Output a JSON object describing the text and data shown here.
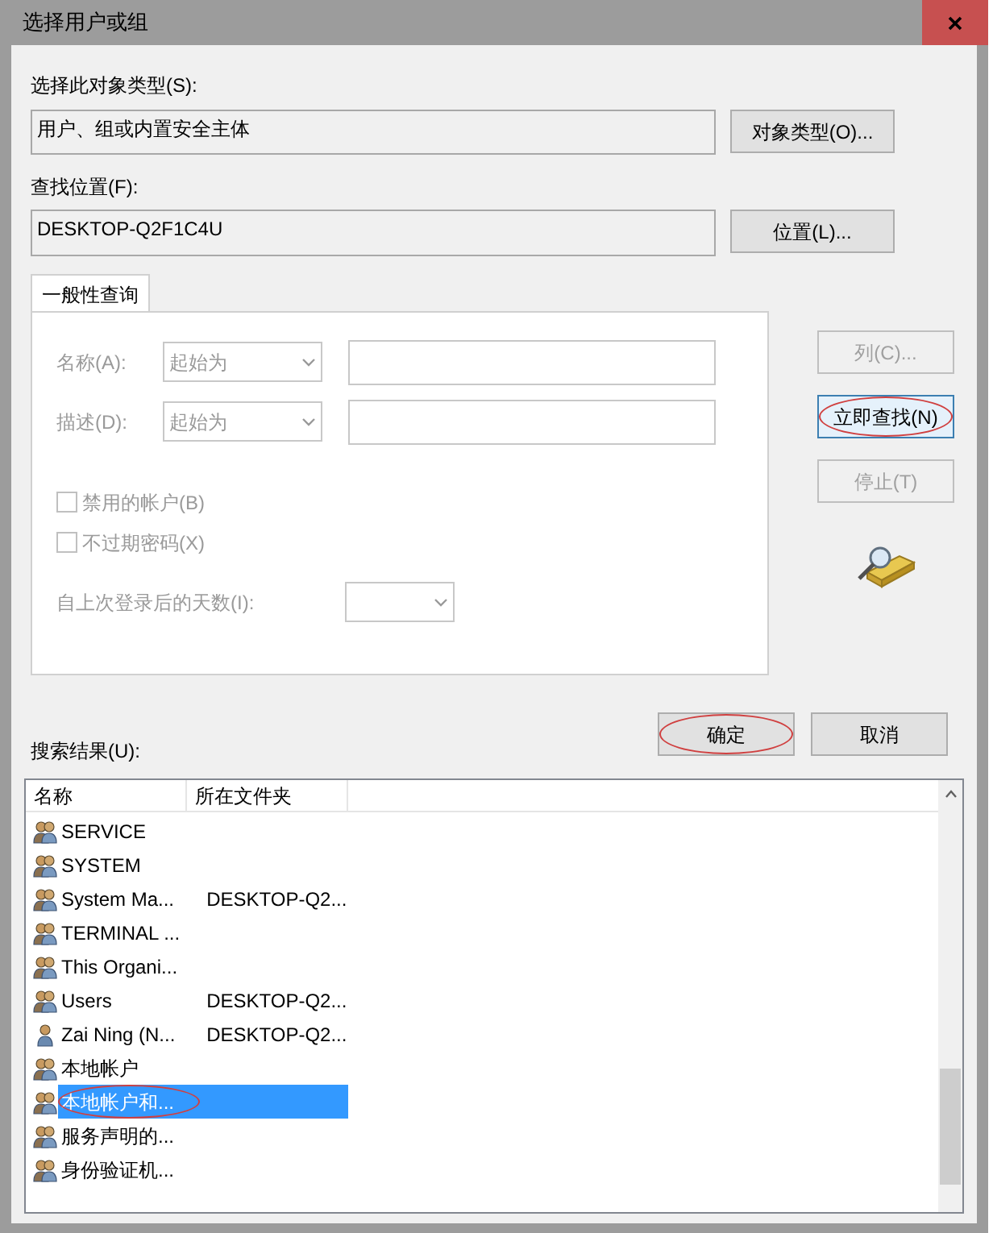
{
  "window": {
    "title": "选择用户或组"
  },
  "object_type": {
    "label": "选择此对象类型(S):",
    "value": "用户、组或内置安全主体",
    "button": "对象类型(O)..."
  },
  "location": {
    "label": "查找位置(F):",
    "value": "DESKTOP-Q2F1C4U",
    "button": "位置(L)..."
  },
  "tabs": [
    {
      "label": "一般性查询",
      "selected": true
    }
  ],
  "query": {
    "disabled": true,
    "fields": [
      {
        "label": "名称(A):",
        "mode": "起始为"
      },
      {
        "label": "描述(D):",
        "mode": "起始为"
      }
    ],
    "checkboxes": [
      {
        "label": "禁用的帐户(B)",
        "checked": false
      },
      {
        "label": "不过期密码(X)",
        "checked": false
      }
    ],
    "days_label": "自上次登录后的天数(I):"
  },
  "side_buttons": [
    {
      "label": "列(C)...",
      "disabled": true,
      "default": false,
      "circled": false
    },
    {
      "label": "立即查找(N)",
      "disabled": false,
      "default": true,
      "circled": true
    },
    {
      "label": "停止(T)",
      "disabled": true,
      "default": false,
      "circled": false
    }
  ],
  "dialog_buttons": [
    {
      "label": "确定",
      "circled": true
    },
    {
      "label": "取消",
      "circled": false
    }
  ],
  "results": {
    "label": "搜索结果(U):",
    "columns": [
      "名称",
      "所在文件夹"
    ],
    "rows": [
      {
        "kind": "group",
        "name": "SERVICE",
        "selected": false,
        "circled": false
      },
      {
        "kind": "group",
        "name": "SYSTEM",
        "selected": false,
        "circled": false
      },
      {
        "kind": "group",
        "name": "System Ma...",
        "folder": "DESKTOP-Q2...",
        "selected": false,
        "circled": false
      },
      {
        "kind": "group",
        "name": "TERMINAL ...",
        "selected": false,
        "circled": false
      },
      {
        "kind": "group",
        "name": "This Organi...",
        "selected": false,
        "circled": false
      },
      {
        "kind": "group",
        "name": "Users",
        "folder": "DESKTOP-Q2...",
        "selected": false,
        "circled": false
      },
      {
        "kind": "user",
        "name": "Zai Ning (N...",
        "folder": "DESKTOP-Q2...",
        "selected": false,
        "circled": false
      },
      {
        "kind": "group",
        "name": "本地帐户",
        "selected": false,
        "circled": false
      },
      {
        "kind": "group",
        "name": "本地帐户和...",
        "selected": true,
        "circled": true
      },
      {
        "kind": "group",
        "name": "服务声明的...",
        "selected": false,
        "circled": false
      },
      {
        "kind": "group",
        "name": "身份验证机...",
        "selected": false,
        "circled": false
      }
    ]
  }
}
